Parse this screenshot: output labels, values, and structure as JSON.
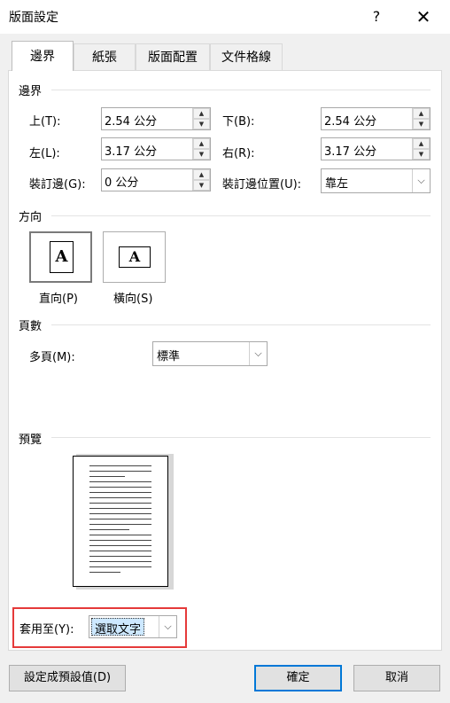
{
  "window": {
    "title": "版面設定",
    "help_label": "?",
    "close_label": "✕"
  },
  "tabs": [
    {
      "label": "邊界"
    },
    {
      "label": "紙張"
    },
    {
      "label": "版面配置"
    },
    {
      "label": "文件格線"
    }
  ],
  "margins": {
    "section_label": "邊界",
    "top": {
      "label": "上(T):",
      "value": "2.54 公分"
    },
    "bottom": {
      "label": "下(B):",
      "value": "2.54 公分"
    },
    "left": {
      "label": "左(L):",
      "value": "3.17 公分"
    },
    "right": {
      "label": "右(R):",
      "value": "3.17 公分"
    },
    "gutter": {
      "label": "裝訂邊(G):",
      "value": "0 公分"
    },
    "gutter_position": {
      "label": "裝訂邊位置(U):",
      "value": "靠左"
    }
  },
  "orientation": {
    "section_label": "方向",
    "portrait_label": "直向(P)",
    "landscape_label": "橫向(S)",
    "icon_letter": "A",
    "selected": "portrait"
  },
  "pages": {
    "section_label": "頁數",
    "multiple_label": "多頁(M):",
    "multiple_value": "標準"
  },
  "preview": {
    "section_label": "預覽"
  },
  "apply_to": {
    "label": "套用至(Y):",
    "value": "選取文字"
  },
  "buttons": {
    "set_default": "設定成預設值(D)",
    "ok": "確定",
    "cancel": "取消"
  },
  "icons": {
    "spin_up": "spin-up-arrow-icon",
    "spin_down": "spin-down-arrow-icon",
    "dropdown": "chevron-down-icon"
  }
}
